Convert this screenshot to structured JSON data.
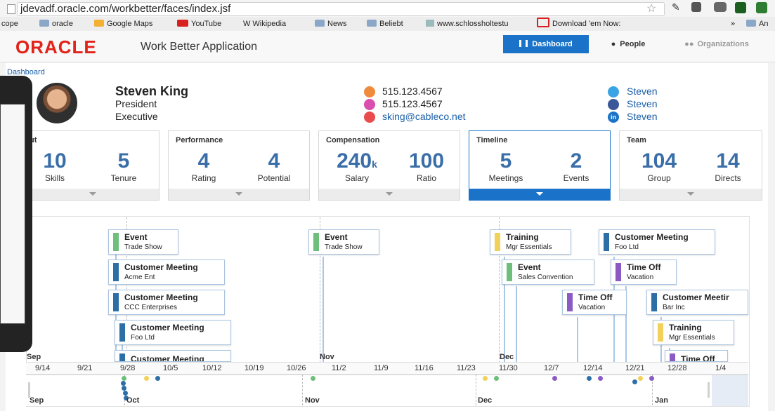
{
  "browser": {
    "url": "jdevadf.oracle.com/workbetter/faces/index.jsf",
    "bookmarks": [
      "cope",
      "oracle",
      "Google Maps",
      "YouTube",
      "Wikipedia",
      "News",
      "Beliebt",
      "www.schlossholtestu",
      "Download 'em Now:",
      "»",
      "An"
    ]
  },
  "app": {
    "logo": "ORACLE",
    "title": "Work Better Application",
    "nav": [
      "Dashboard",
      "People",
      "Organizations"
    ],
    "breadcrumb": "Dashboard"
  },
  "profile": {
    "name": "Steven King",
    "role": "President",
    "group": "Executive",
    "phone1": "515.123.4567",
    "phone2": "515.123.4567",
    "email": "sking@cableco.net",
    "twitter": "Steven",
    "facebook": "Steven",
    "linkedin": "Steven",
    "linkedin_badge": "in"
  },
  "stats": [
    {
      "title": "ut",
      "items": [
        {
          "value": "10",
          "label": "Skills"
        },
        {
          "value": "5",
          "label": "Tenure"
        }
      ]
    },
    {
      "title": "Performance",
      "items": [
        {
          "value": "4",
          "label": "Rating"
        },
        {
          "value": "4",
          "label": "Potential"
        }
      ]
    },
    {
      "title": "Compensation",
      "items": [
        {
          "value": "240",
          "suffix": "k",
          "label": "Salary"
        },
        {
          "value": "100",
          "label": "Ratio"
        }
      ]
    },
    {
      "title": "Timeline",
      "items": [
        {
          "value": "5",
          "label": "Meetings"
        },
        {
          "value": "2",
          "label": "Events"
        }
      ]
    },
    {
      "title": "Team",
      "items": [
        {
          "value": "104",
          "label": "Group"
        },
        {
          "value": "14",
          "label": "Directs"
        }
      ]
    }
  ],
  "timeline": {
    "events": [
      {
        "title": "Event",
        "sub": "Trade Show",
        "color": "#6dbf7b"
      },
      {
        "title": "Customer Meeting",
        "sub": "Acme Ent",
        "color": "#2c6fa6"
      },
      {
        "title": "Customer Meeting",
        "sub": "CCC Enterprises",
        "color": "#2c6fa6"
      },
      {
        "title": "Customer Meeting",
        "sub": "Foo Ltd",
        "color": "#2c6fa6"
      },
      {
        "title": "Customer Meeting",
        "sub": "",
        "color": "#2c6fa6"
      },
      {
        "title": "Event",
        "sub": "Trade Show",
        "color": "#6dbf7b"
      },
      {
        "title": "Training",
        "sub": "Mgr Essentials",
        "color": "#f2d15a"
      },
      {
        "title": "Event",
        "sub": "Sales Convention",
        "color": "#6dbf7b"
      },
      {
        "title": "Time Off",
        "sub": "Vacation",
        "color": "#8a5bc4"
      },
      {
        "title": "Customer Meeting",
        "sub": "Foo Ltd",
        "color": "#2c6fa6"
      },
      {
        "title": "Time Off",
        "sub": "Vacation",
        "color": "#8a5bc4"
      },
      {
        "title": "Customer Meetir",
        "sub": "Bar Inc",
        "color": "#2c6fa6"
      },
      {
        "title": "Training",
        "sub": "Mgr Essentials",
        "color": "#f2d15a"
      },
      {
        "title": "Time Off",
        "sub": "",
        "color": "#8a5bc4"
      }
    ],
    "months_top": [
      "Sep",
      "Nov",
      "Dec"
    ],
    "ticks": [
      "9/14",
      "9/21",
      "9/28",
      "10/5",
      "10/12",
      "10/19",
      "10/26",
      "11/2",
      "11/9",
      "11/16",
      "11/23",
      "11/30",
      "12/7",
      "12/14",
      "12/21",
      "12/28",
      "1/4"
    ],
    "overview_months": [
      "Sep",
      "Oct",
      "Nov",
      "Dec",
      "Jan"
    ]
  },
  "colors": {
    "brand": "#e2231a",
    "accent": "#1a73c8",
    "number": "#3a6ea8"
  }
}
